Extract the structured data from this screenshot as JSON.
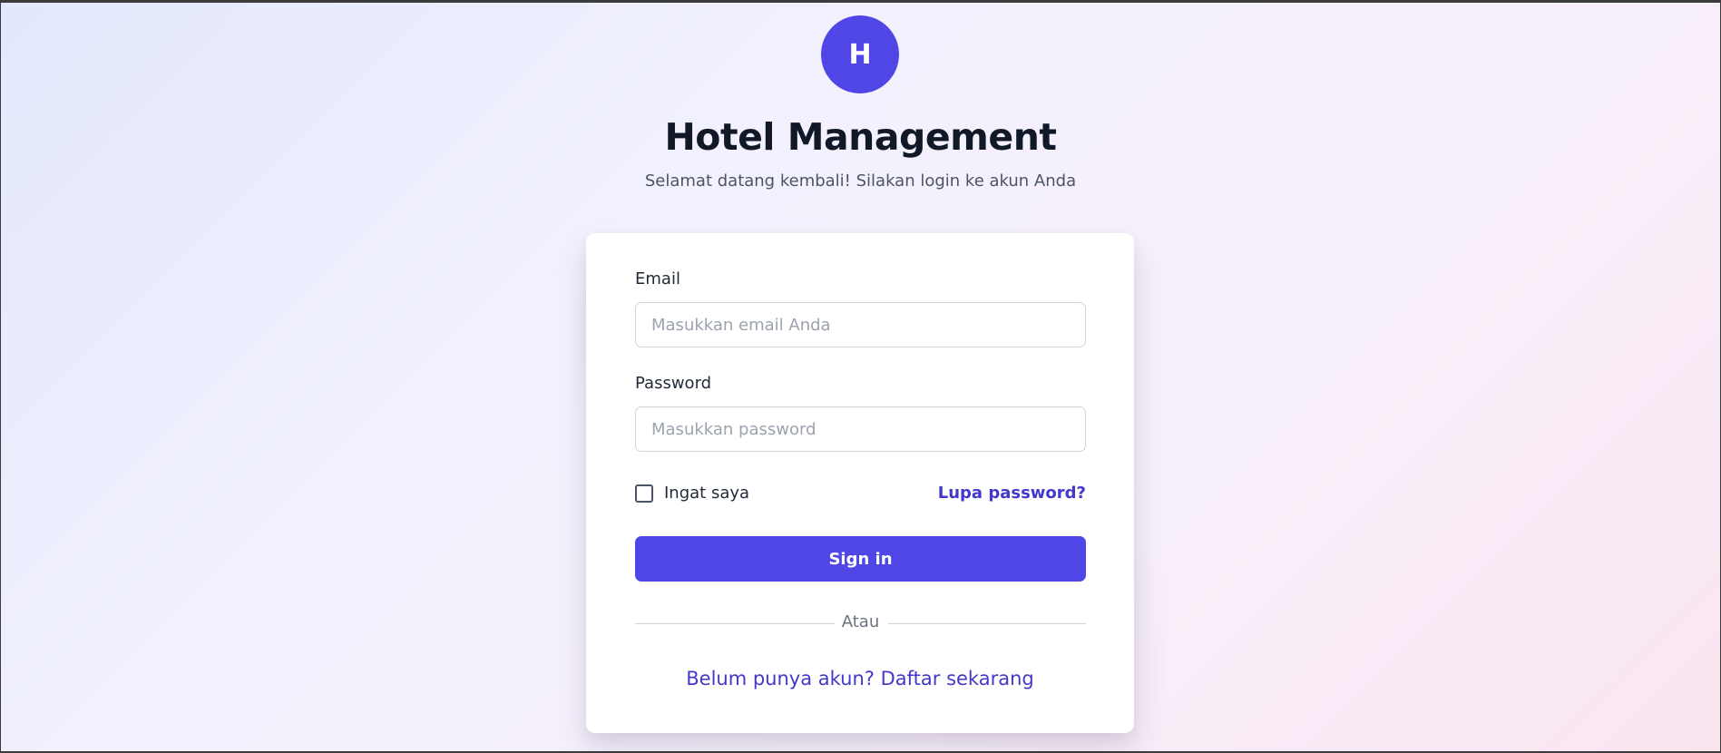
{
  "logo": {
    "letter": "H"
  },
  "header": {
    "title": "Hotel Management",
    "subtitle": "Selamat datang kembali! Silakan login ke akun Anda"
  },
  "form": {
    "email_label": "Email",
    "email_placeholder": "Masukkan email Anda",
    "email_value": "",
    "password_label": "Password",
    "password_placeholder": "Masukkan password",
    "password_value": "",
    "remember_label": "Ingat saya",
    "remember_checked": false,
    "forgot_link": "Lupa password?",
    "signin_label": "Sign in",
    "divider_text": "Atau",
    "signup_link": "Belum punya akun? Daftar sekarang"
  },
  "colors": {
    "accent": "#4f46e5",
    "link": "#4338ca",
    "title": "#111827"
  }
}
